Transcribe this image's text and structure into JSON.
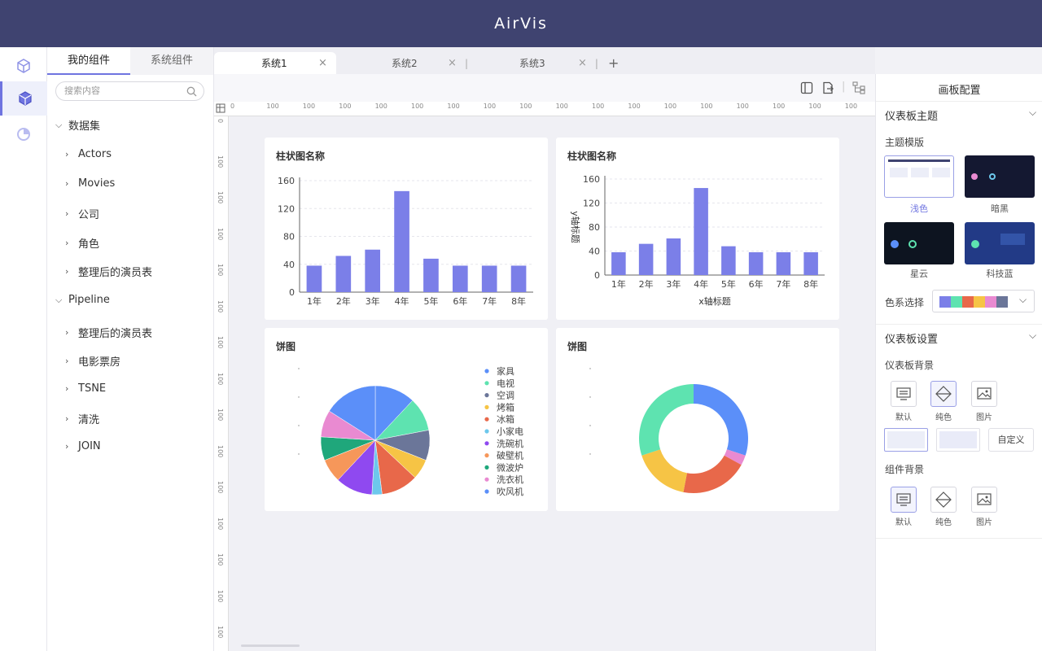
{
  "app": {
    "title": "AirVis"
  },
  "left_panel": {
    "tabs": [
      "我的组件",
      "系统组件"
    ],
    "search_placeholder": "搜索内容",
    "groups": [
      {
        "label": "数据集",
        "items": [
          "Actors",
          "Movies",
          "公司",
          "角色",
          "整理后的演员表"
        ]
      },
      {
        "label": "Pipeline",
        "items": [
          "整理后的演员表",
          "电影票房",
          "TSNE",
          "清洗",
          "JOIN"
        ]
      }
    ]
  },
  "tabs": [
    {
      "label": "系统1",
      "active": true
    },
    {
      "label": "系统2",
      "active": false
    },
    {
      "label": "系统3",
      "active": false
    }
  ],
  "add_tab": "+",
  "ruler": {
    "h_labels": [
      "0",
      "100",
      "100",
      "100",
      "100",
      "100",
      "100",
      "100",
      "100",
      "100",
      "100",
      "100",
      "100",
      "100",
      "100",
      "100",
      "100",
      "100"
    ],
    "v_labels": [
      "0",
      "100",
      "100",
      "100",
      "100",
      "100",
      "100",
      "100",
      "100",
      "100",
      "100",
      "100",
      "100",
      "100",
      "100"
    ]
  },
  "cards": {
    "bar1": {
      "title": "柱状图名称"
    },
    "bar2": {
      "title": "柱状图名称"
    },
    "pie1": {
      "title": "饼图"
    },
    "pie2": {
      "title": "饼图"
    }
  },
  "chart_data": [
    {
      "type": "bar",
      "title": "柱状图名称",
      "categories": [
        "1年",
        "2年",
        "3年",
        "4年",
        "5年",
        "6年",
        "7年",
        "8年"
      ],
      "values": [
        38,
        52,
        61,
        145,
        48,
        38,
        38,
        38
      ],
      "ylim": [
        0,
        160
      ],
      "yticks": [
        0,
        40,
        80,
        120,
        160
      ],
      "xlabel": "",
      "ylabel": "",
      "color": "#7b7fe8"
    },
    {
      "type": "bar",
      "title": "柱状图名称",
      "categories": [
        "1年",
        "2年",
        "3年",
        "4年",
        "5年",
        "6年",
        "7年",
        "8年"
      ],
      "values": [
        38,
        52,
        61,
        145,
        48,
        38,
        38,
        38
      ],
      "ylim": [
        0,
        160
      ],
      "yticks": [
        0,
        40,
        80,
        120,
        160
      ],
      "xlabel": "x轴标题",
      "ylabel": "y轴标题",
      "color": "#7b7fe8"
    },
    {
      "type": "pie",
      "title": "饼图",
      "legend": "right",
      "slices": [
        {
          "name": "家具",
          "value": 12,
          "color": "#5b8ff9"
        },
        {
          "name": "电视",
          "value": 10,
          "color": "#5ee3b0"
        },
        {
          "name": "空调",
          "value": 9,
          "color": "#6b7699"
        },
        {
          "name": "烤箱",
          "value": 6,
          "color": "#f6c445"
        },
        {
          "name": "冰箱",
          "value": 11,
          "color": "#e8684a"
        },
        {
          "name": "小家电",
          "value": 3,
          "color": "#6dc8ec"
        },
        {
          "name": "洗碗机",
          "value": 11,
          "color": "#8f49f0"
        },
        {
          "name": "破壁机",
          "value": 7,
          "color": "#f6975a"
        },
        {
          "name": "微波炉",
          "value": 7,
          "color": "#1fa77b"
        },
        {
          "name": "洗衣机",
          "value": 8,
          "color": "#e98ad1"
        },
        {
          "name": "吹风机",
          "value": 16,
          "color": "#5b8ff9"
        }
      ]
    },
    {
      "type": "pie",
      "title": "饼图",
      "donut": true,
      "slices": [
        {
          "value": 30,
          "color": "#5b8ff9"
        },
        {
          "value": 3,
          "color": "#e98ad1"
        },
        {
          "value": 20,
          "color": "#e8684a"
        },
        {
          "value": 17,
          "color": "#f6c445"
        },
        {
          "value": 30,
          "color": "#5ee3b0"
        }
      ]
    }
  ],
  "right_panel": {
    "title": "画板配置",
    "theme_section": "仪表板主题",
    "theme_template_label": "主题模版",
    "themes": [
      "浅色",
      "暗黑",
      "星云",
      "科技蓝"
    ],
    "palette_label": "色系选择",
    "palette": [
      "#7b7fe8",
      "#5ee3b0",
      "#e8684a",
      "#f6c445",
      "#e98ad1",
      "#6b7699"
    ],
    "settings_section": "仪表板设置",
    "bg_label": "仪表板背景",
    "bg_options": [
      "默认",
      "纯色",
      "图片"
    ],
    "custom_button": "自定义",
    "comp_bg_label": "组件背景",
    "comp_bg_options": [
      "默认",
      "纯色",
      "图片"
    ]
  }
}
